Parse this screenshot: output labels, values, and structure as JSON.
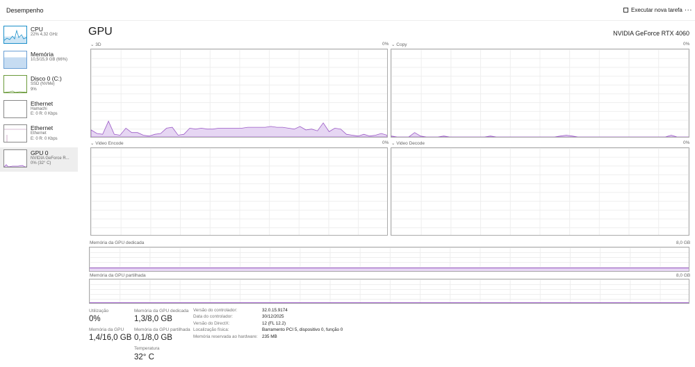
{
  "header": {
    "title": "Desempenho",
    "run_task": "Executar nova tarefa",
    "more": "..."
  },
  "sidebar": [
    {
      "name": "CPU",
      "sub1": "22% 4,32 GHz",
      "sub2": ""
    },
    {
      "name": "Memória",
      "sub1": "10,5/15,9 GB (66%)",
      "sub2": ""
    },
    {
      "name": "Disco 0 (C:)",
      "sub1": "SSD (NVMe)",
      "sub2": "9%"
    },
    {
      "name": "Ethernet",
      "sub1": "Hamachi",
      "sub2": "E: 0 R: 0 Kbps"
    },
    {
      "name": "Ethernet",
      "sub1": "Ethernet",
      "sub2": "E: 0 R: 0 Kbps"
    },
    {
      "name": "GPU 0",
      "sub1": "NVIDIA GeForce R...",
      "sub2": "0% (32° C)"
    }
  ],
  "main": {
    "title": "GPU",
    "model": "NVIDIA GeForce RTX 4060"
  },
  "graphs": {
    "g3d": {
      "label": "3D",
      "value": "0%",
      "samples": [
        8,
        4,
        3,
        18,
        3,
        2,
        10,
        5,
        5,
        2,
        1,
        3,
        4,
        10,
        11,
        2,
        3,
        10,
        9,
        10,
        9,
        9,
        10,
        10,
        10,
        10,
        10,
        11,
        11,
        11,
        11,
        12,
        11,
        11,
        10,
        9,
        12,
        8,
        9,
        7,
        16,
        6,
        10,
        9,
        3,
        2,
        1,
        3,
        1,
        2,
        4,
        2
      ]
    },
    "copy": {
      "label": "Copy",
      "value": "0%",
      "samples": [
        1,
        0,
        0,
        0,
        5,
        1,
        0,
        0,
        0,
        1,
        0,
        0,
        0,
        0,
        0,
        0,
        0,
        1,
        0,
        0,
        0,
        0,
        0,
        0,
        0,
        0,
        0,
        0,
        0,
        1,
        2,
        1,
        0,
        0,
        0,
        0,
        0,
        0,
        0,
        0,
        0,
        0,
        0,
        0,
        0,
        0,
        0,
        0,
        2,
        0,
        0,
        0
      ]
    },
    "encode": {
      "label": "Video Encode",
      "value": "0%"
    },
    "decode": {
      "label": "Video Decode",
      "value": "0%"
    },
    "dedicated": {
      "label": "Memória da GPU dedicada",
      "max": "8,0 GB",
      "fraction": 0.16
    },
    "shared": {
      "label": "Memória da GPU partilhada",
      "max": "8,0 GB",
      "fraction": 0.01
    }
  },
  "stats": {
    "util_label": "Utilização",
    "util": "0%",
    "gpumem_label": "Memória da GPU",
    "gpumem": "1,4/16,0 GB",
    "ded_label": "Memória da GPU dedicada",
    "ded": "1,3/8,0 GB",
    "shr_label": "Memória da GPU partilhada",
    "shr": "0,1/8,0 GB",
    "temp_label": "Temperatura",
    "temp": "32° C"
  },
  "details": [
    {
      "k": "Versão do controlador:",
      "v": "32.0.15.9174"
    },
    {
      "k": "Data do controlador:",
      "v": "30/12/2025"
    },
    {
      "k": "Versão do DirectX:",
      "v": "12 (FL 12.2)"
    },
    {
      "k": "Localização física:",
      "v": "Barramento PCI 5, dispositivo 0, função 0"
    },
    {
      "k": "Memória reservada ao hardware:",
      "v": "235 MB"
    }
  ],
  "colors": {
    "gpu": "#9b5bc6",
    "gpu_fill": "#e6d6f3",
    "cpu": "#1a8fc9",
    "mem_fill": "#c6dcf2"
  }
}
